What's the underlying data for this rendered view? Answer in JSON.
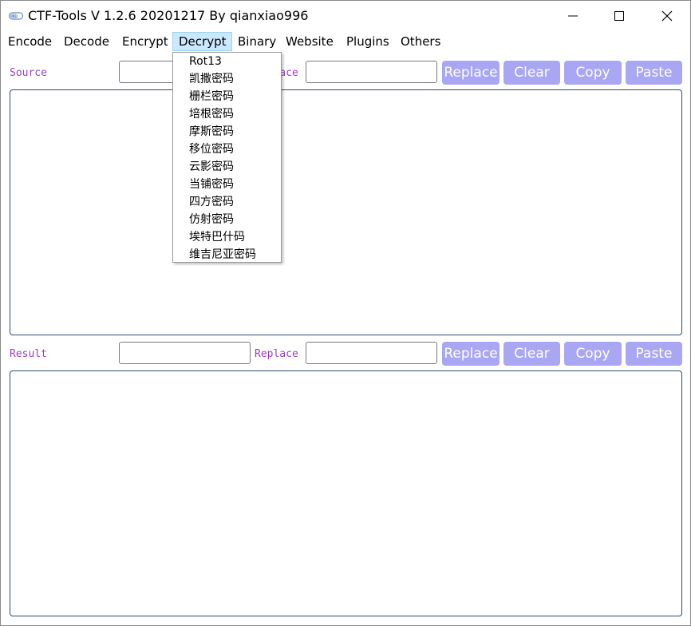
{
  "window": {
    "title": "CTF-Tools V 1.2.6 20201217 By qianxiao996",
    "icon": "ctf-app-icon",
    "controls": {
      "minimize": "minimize-icon",
      "maximize": "maximize-icon",
      "close": "close-icon"
    }
  },
  "menu": {
    "items": [
      "Encode",
      "Decode",
      "Encrypt",
      "Decrypt",
      "Binary",
      "Website",
      "Plugins",
      "Others"
    ],
    "active": "Decrypt"
  },
  "dropdown": {
    "items": [
      "Rot13",
      "凯撒密码",
      "栅栏密码",
      "培根密码",
      "摩斯密码",
      "移位密码",
      "云影密码",
      "当铺密码",
      "四方密码",
      "仿射密码",
      "埃特巴什码",
      "维吉尼亚密码"
    ]
  },
  "source_row": {
    "label": "Source",
    "input_value": "",
    "replace_label": "Replace",
    "replace_value": "",
    "buttons": [
      "Replace",
      "Clear",
      "Copy",
      "Paste"
    ]
  },
  "result_row": {
    "label": "Result",
    "input_value": "",
    "replace_label": "Replace",
    "replace_value": "",
    "buttons": [
      "Replace",
      "Clear",
      "Copy",
      "Paste"
    ]
  },
  "source_text": "",
  "result_text": "",
  "colors": {
    "label": "#9b3fc4",
    "button_bg": "#a9a6f4",
    "button_text": "#ffffff",
    "menu_active_bg": "#cce8ff"
  }
}
